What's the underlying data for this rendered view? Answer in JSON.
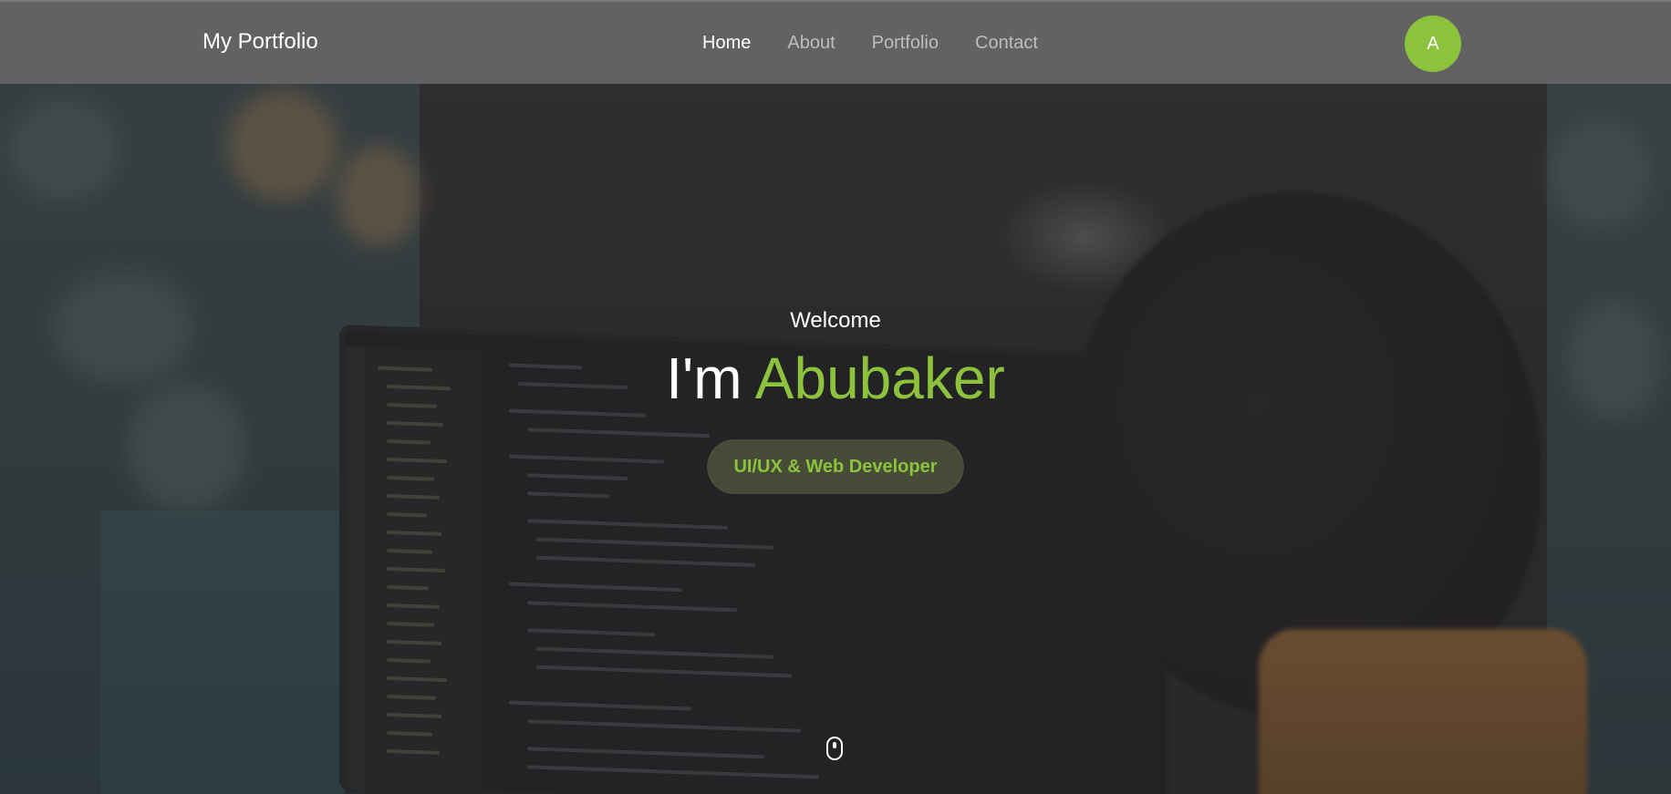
{
  "navbar": {
    "brand": "My Portfolio",
    "links": [
      {
        "label": "Home",
        "active": true
      },
      {
        "label": "About",
        "active": false
      },
      {
        "label": "Portfolio",
        "active": false
      },
      {
        "label": "Contact",
        "active": false
      }
    ],
    "avatar_initial": "A"
  },
  "hero": {
    "welcome": "Welcome",
    "headline_prefix": "I'm",
    "headline_name": "Abubaker",
    "role": "UI/UX & Web Developer",
    "scroll_indicator_icon": "mouse-scroll-icon"
  },
  "colors": {
    "accent": "#8dc23c",
    "navbar_bg": "#646365",
    "text_primary": "#ffffff",
    "nav_inactive": "#bdbdbd"
  }
}
